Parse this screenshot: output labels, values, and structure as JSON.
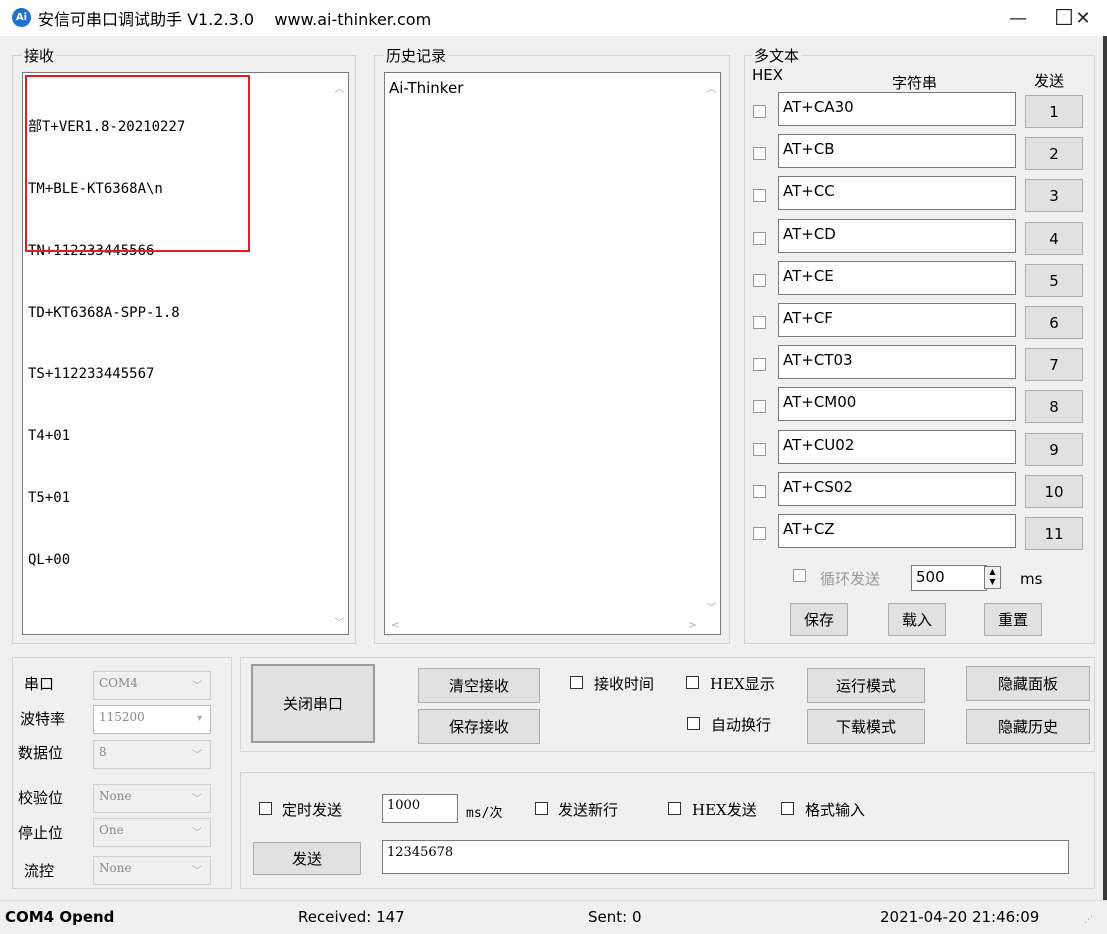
{
  "window": {
    "icon_text": "Ai",
    "title": "安信可串口调试助手 V1.2.3.0    www.ai-thinker.com",
    "minimize": "—",
    "maximize": "☐",
    "close": "✕"
  },
  "receive": {
    "label": "接收",
    "lines": [
      "部T+VER1.8-20210227",
      "TM+BLE-KT6368A\\n",
      "TN+112233445566",
      "TD+KT6368A-SPP-1.8",
      "TS+112233445567",
      "T4+01",
      "T5+01",
      "QL+00"
    ],
    "highlight_color": "#e02020"
  },
  "history": {
    "label": "历史记录",
    "items": [
      "Ai-Thinker"
    ]
  },
  "multi": {
    "label": "多文本",
    "hex_header": "HEX",
    "string_header": "字符串",
    "send_header": "发送",
    "rows": [
      {
        "text": "AT+CA30",
        "button": "1"
      },
      {
        "text": "AT+CB",
        "button": "2"
      },
      {
        "text": "AT+CC",
        "button": "3"
      },
      {
        "text": "AT+CD",
        "button": "4"
      },
      {
        "text": "AT+CE",
        "button": "5"
      },
      {
        "text": "AT+CF",
        "button": "6"
      },
      {
        "text": "AT+CT03",
        "button": "7"
      },
      {
        "text": "AT+CM00",
        "button": "8"
      },
      {
        "text": "AT+CU02",
        "button": "9"
      },
      {
        "text": "AT+CS02",
        "button": "10"
      },
      {
        "text": "AT+CZ",
        "button": "11"
      }
    ],
    "loop_label": "循环发送",
    "loop_value": "500",
    "loop_unit": "ms",
    "save": "保存",
    "load": "载入",
    "reset": "重置"
  },
  "serial": {
    "port_label": "串口",
    "port_value": "COM4",
    "baud_label": "波特率",
    "baud_value": "115200",
    "databits_label": "数据位",
    "databits_value": "8",
    "parity_label": "校验位",
    "parity_value": "None",
    "stopbits_label": "停止位",
    "stopbits_value": "One",
    "flow_label": "流控",
    "flow_value": "None"
  },
  "controls": {
    "close_port": "关闭串口",
    "clear_receive": "清空接收",
    "save_receive": "保存接收",
    "receive_time": "接收时间",
    "hex_display": "HEX显示",
    "auto_wrap": "自动换行",
    "run_mode": "运行模式",
    "download_mode": "下载模式",
    "hide_panel": "隐藏面板",
    "hide_history": "隐藏历史"
  },
  "send": {
    "timed_send": "定时发送",
    "interval": "1000",
    "interval_unit": "ms/次",
    "send_newline": "发送新行",
    "hex_send": "HEX发送",
    "format_input": "格式输入",
    "send_button": "发送",
    "send_text": "12345678"
  },
  "status": {
    "port": "COM4 Opend",
    "received": "Received: 147",
    "sent": "Sent: 0",
    "datetime": "2021-04-20 21:46:09"
  }
}
